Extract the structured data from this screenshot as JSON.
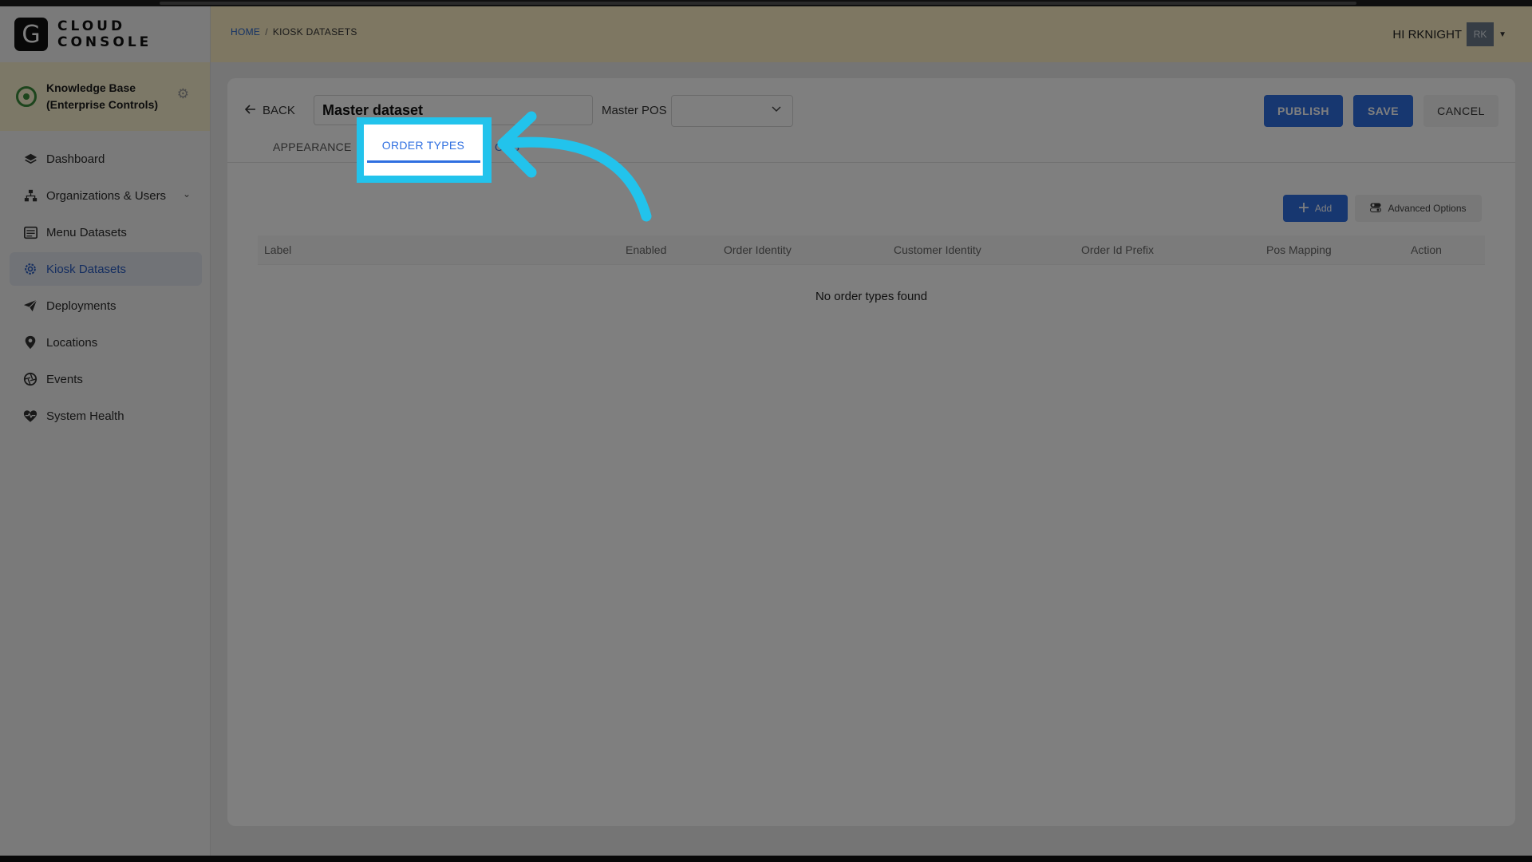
{
  "brand": {
    "logo_letter": "G",
    "line1": "CLOUD",
    "line2": "CONSOLE"
  },
  "org": {
    "name": "Knowledge Base (Enterprise Controls)"
  },
  "nav": [
    {
      "label": "Dashboard",
      "icon": "layers-icon"
    },
    {
      "label": "Organizations & Users",
      "icon": "org-tree-icon"
    },
    {
      "label": "Menu Datasets",
      "icon": "menu-icon"
    },
    {
      "label": "Kiosk Datasets",
      "icon": "gear-icon"
    },
    {
      "label": "Deployments",
      "icon": "paper-plane-icon"
    },
    {
      "label": "Locations",
      "icon": "map-pin-icon"
    },
    {
      "label": "Events",
      "icon": "aperture-icon"
    },
    {
      "label": "System Health",
      "icon": "heart-pulse-icon"
    }
  ],
  "breadcrumb": {
    "home": "HOME",
    "separator": "/",
    "current": "KIOSK DATASETS"
  },
  "user": {
    "greeting": "HI RKNIGHT",
    "initials": "RK"
  },
  "editor": {
    "back_label": "BACK",
    "dataset_name": "Master dataset",
    "pos_label": "Master POS",
    "pos_value": "",
    "publish_label": "PUBLISH",
    "save_label": "SAVE",
    "cancel_label": "CANCEL"
  },
  "tabs": {
    "appearance": "APPEARANCE",
    "order_types": "ORDER TYPES",
    "third_partial": "ONS"
  },
  "table": {
    "add_label": "Add",
    "advanced_label": "Advanced Options",
    "columns": [
      "Label",
      "Enabled",
      "Order Identity",
      "Customer Identity",
      "Order Id Prefix",
      "Pos Mapping",
      "Action"
    ],
    "empty_message": "No order types found"
  },
  "colors": {
    "accent": "#2f6fe0",
    "highlight": "#22c3ec",
    "header_bg": "#fcefc5"
  }
}
